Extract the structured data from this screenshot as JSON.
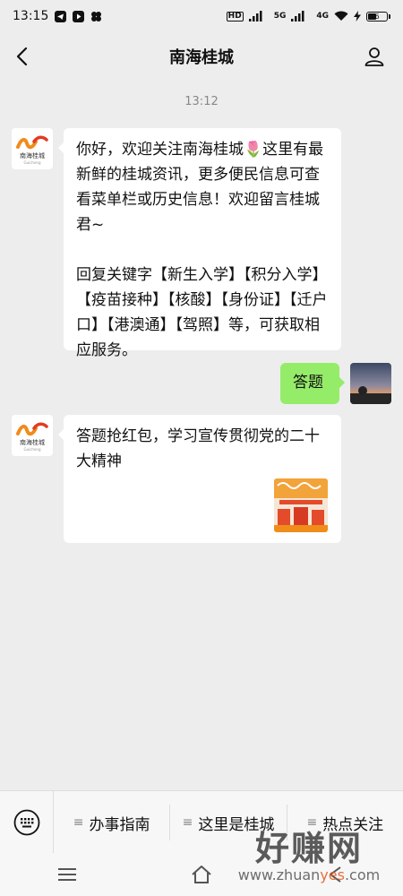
{
  "status": {
    "time": "13:15",
    "hd": "HD",
    "net1": "5G",
    "net2": "4G",
    "battery": "6"
  },
  "header": {
    "title": "南海桂城"
  },
  "chat": {
    "timestamp": "13:12",
    "avatar_brand": "南海桂城",
    "avatar_brand_en": "Guicheng",
    "messages": [
      {
        "side": "left",
        "text": "你好，欢迎关注南海桂城🌷这里有最新鲜的桂城资讯，更多便民信息可查看菜单栏或历史信息！欢迎留言桂城君~",
        "text2": "回复关键字【新生入学】【积分入学】【疫苗接种】【核酸】【身份证】【迁户口】【港澳通】【驾照】等，可获取相应服务。"
      },
      {
        "side": "right",
        "text": "答题"
      },
      {
        "side": "left",
        "text": "答题抢红包，学习宣传贯彻党的二十大精神"
      }
    ]
  },
  "menu": {
    "items": [
      {
        "label": "办事指南"
      },
      {
        "label": "这里是桂城"
      },
      {
        "label": "热点关注"
      }
    ]
  },
  "watermark": {
    "big": "好赚网",
    "small_a": "www.zhuan",
    "small_b": "yes",
    "small_c": ".com"
  },
  "colors": {
    "bubble_right": "#95ec69",
    "background": "#ededed"
  }
}
